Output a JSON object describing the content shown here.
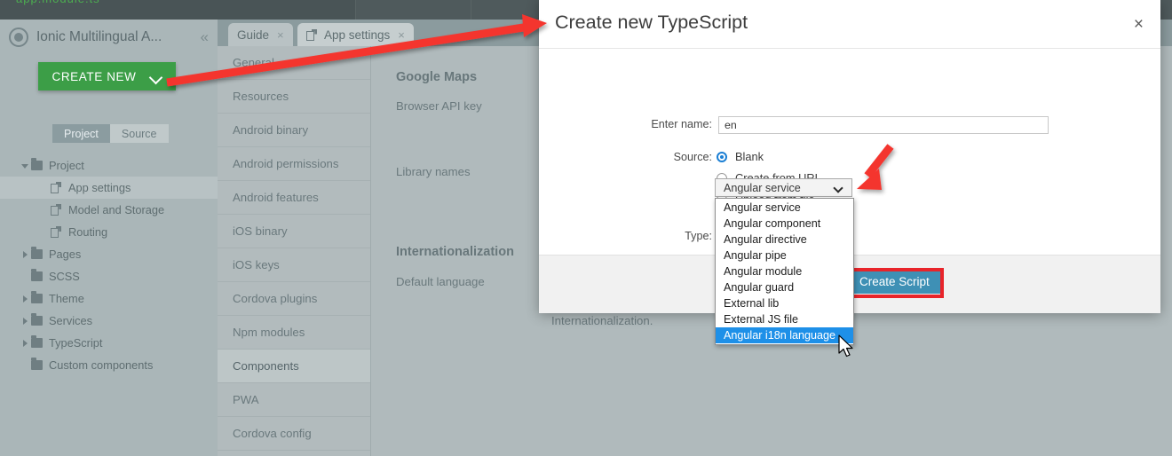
{
  "app": {
    "sidebar": {
      "project_name": "Ionic Multilingual A...",
      "collapse_icon": "chevron-double-left-icon",
      "create_new_label": "CREATE NEW",
      "segments": [
        {
          "label": "Project",
          "active": true
        },
        {
          "label": "Source",
          "active": false
        }
      ],
      "tree": [
        {
          "label": "Project",
          "type": "folder",
          "twisty": "open",
          "depth": 0,
          "selected": false
        },
        {
          "label": "App settings",
          "type": "file",
          "twisty": "none",
          "depth": 1,
          "selected": true
        },
        {
          "label": "Model and Storage",
          "type": "file",
          "twisty": "none",
          "depth": 1,
          "selected": false
        },
        {
          "label": "Routing",
          "type": "file",
          "twisty": "none",
          "depth": 1,
          "selected": false
        },
        {
          "label": "Pages",
          "type": "folder",
          "twisty": "closed",
          "depth": 0,
          "selected": false
        },
        {
          "label": "SCSS",
          "type": "folder",
          "twisty": "none",
          "depth": 0,
          "selected": false
        },
        {
          "label": "Theme",
          "type": "folder",
          "twisty": "closed",
          "depth": 0,
          "selected": false
        },
        {
          "label": "Services",
          "type": "folder",
          "twisty": "closed",
          "depth": 0,
          "selected": false
        },
        {
          "label": "TypeScript",
          "type": "folder",
          "twisty": "closed",
          "depth": 0,
          "selected": false
        },
        {
          "label": "Custom components",
          "type": "folder",
          "twisty": "none",
          "depth": 0,
          "selected": false
        }
      ]
    },
    "tabs": [
      {
        "label": "Guide",
        "icon": "none",
        "active": false,
        "close": "×"
      },
      {
        "label": "App settings",
        "icon": "file-icon",
        "active": true,
        "close": "×"
      }
    ],
    "settings_list": [
      {
        "label": "General",
        "selected": false
      },
      {
        "label": "Resources",
        "selected": false
      },
      {
        "label": "Android binary",
        "selected": false
      },
      {
        "label": "Android permissions",
        "selected": false
      },
      {
        "label": "Android features",
        "selected": false
      },
      {
        "label": "iOS binary",
        "selected": false
      },
      {
        "label": "iOS keys",
        "selected": false
      },
      {
        "label": "Cordova plugins",
        "selected": false
      },
      {
        "label": "Npm modules",
        "selected": false
      },
      {
        "label": "Components",
        "selected": true
      },
      {
        "label": "PWA",
        "selected": false
      },
      {
        "label": "Cordova config",
        "selected": false
      }
    ],
    "content": {
      "section_google_maps": "Google Maps",
      "field_browser_api_key": "Browser API key",
      "field_library_names": "Library names",
      "section_internationalization": "Internationalization",
      "field_default_language": "Default language",
      "hint_internationalization": "Internationalization."
    }
  },
  "modal": {
    "title": "Create new TypeScript",
    "close_icon": "×",
    "name_label": "Enter name:",
    "name_value": "en",
    "name_placeholder": "",
    "source_label": "Source:",
    "source_options": [
      {
        "label": "Blank",
        "checked": true
      },
      {
        "label": "Create from URL",
        "checked": false
      },
      {
        "label": "Upload from file",
        "checked": false
      }
    ],
    "type_label": "Type:",
    "type_value": "Angular service",
    "type_options": [
      {
        "label": "Angular service",
        "highlight": false
      },
      {
        "label": "Angular component",
        "highlight": false
      },
      {
        "label": "Angular directive",
        "highlight": false
      },
      {
        "label": "Angular pipe",
        "highlight": false
      },
      {
        "label": "Angular module",
        "highlight": false
      },
      {
        "label": "Angular guard",
        "highlight": false
      },
      {
        "label": "External lib",
        "highlight": false
      },
      {
        "label": "External JS file",
        "highlight": false
      },
      {
        "label": "Angular i18n language",
        "highlight": true
      }
    ],
    "submit_label": "Create Script"
  },
  "annotations": {
    "highlight_color": "#e8242a",
    "arrow_color": "#f4342f",
    "accent_green": "#3c9e47",
    "accent_blue": "#3e90b5",
    "dropdown_highlight": "#1e90e8"
  }
}
